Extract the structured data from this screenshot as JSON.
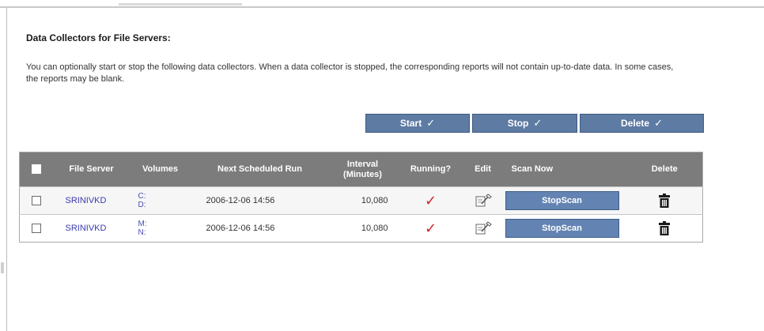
{
  "section": {
    "title": "Data Collectors for File Servers:",
    "description": "You can optionally start or stop the following data collectors. When a data collector is stopped, the corresponding reports will not contain up-to-date data. In some cases, the reports may be blank."
  },
  "actions": {
    "start": "Start",
    "stop": "Stop",
    "delete": "Delete",
    "check_glyph": "✓"
  },
  "table": {
    "headers": {
      "file_server": "File Server",
      "volumes": "Volumes",
      "next_run": "Next Scheduled Run",
      "interval": "Interval (Minutes)",
      "running": "Running?",
      "edit": "Edit",
      "scan_now": "Scan Now",
      "delete": "Delete"
    },
    "rows": [
      {
        "file_server": "SRINIVKD",
        "volume_1": "C:",
        "volume_2": "D:",
        "next_run": "2006-12-06 14:56",
        "interval": "10,080",
        "running_glyph": "✓",
        "scan_button": "StopScan"
      },
      {
        "file_server": "SRINIVKD",
        "volume_1": "M:",
        "volume_2": "N:",
        "next_run": "2006-12-06 14:56",
        "interval": "10,080",
        "running_glyph": "✓",
        "scan_button": "StopScan"
      }
    ]
  },
  "colors": {
    "action_button": "#5d7ba3",
    "table_header": "#7c7c7c",
    "link": "#3b3bb0",
    "running_check": "#c8262b"
  }
}
